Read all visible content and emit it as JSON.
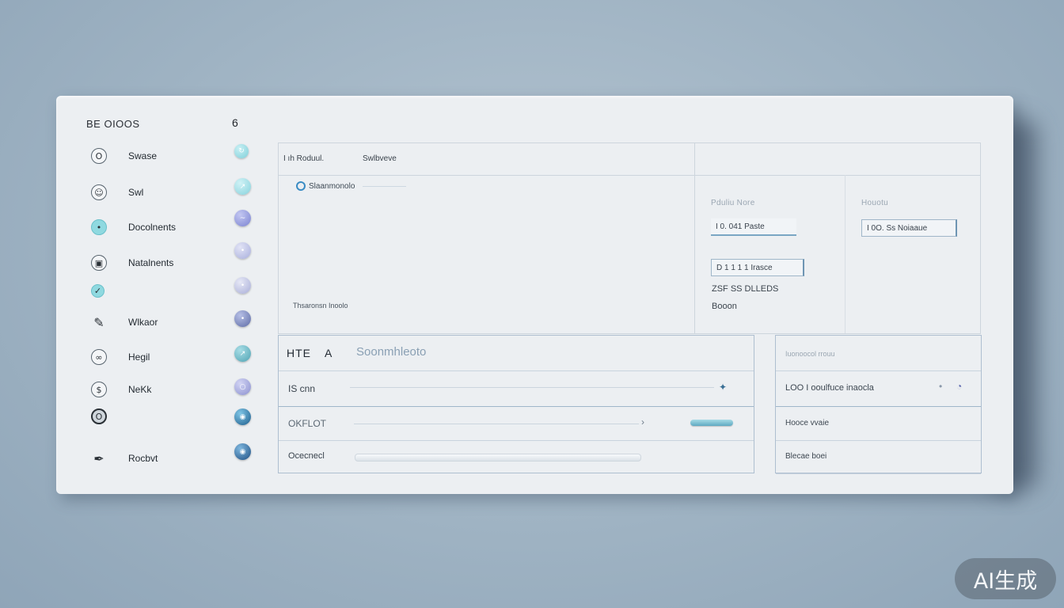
{
  "brand": {
    "name": "BE OIOOS",
    "glyph": "6"
  },
  "sidebar": {
    "items": [
      {
        "icon": "o-icon",
        "glyph": "O",
        "label": "Swase"
      },
      {
        "icon": "person-icon",
        "glyph": "☺",
        "label": "Swl"
      },
      {
        "icon": "dot-icon",
        "glyph": "•",
        "label": "Docolnents"
      },
      {
        "icon": "image-icon",
        "glyph": "▣",
        "label": "Natalnents"
      },
      {
        "icon": "check-icon",
        "glyph": "✓",
        "label": ""
      },
      {
        "icon": "bird-icon",
        "glyph": "✎",
        "label": "Wlkaor"
      },
      {
        "icon": "link-icon",
        "glyph": "∞",
        "label": "Hegil"
      },
      {
        "icon": "dollar-icon",
        "glyph": "$",
        "label": "NeKk"
      },
      {
        "icon": "ring-icon",
        "glyph": "O",
        "label": ""
      },
      {
        "icon": "pen-icon",
        "glyph": "✒",
        "label": "Rocbvt"
      }
    ],
    "orbs": [
      {
        "icon": "refresh-icon",
        "glyph": "↻",
        "color": "#7fcfd9"
      },
      {
        "icon": "arrow-icon",
        "glyph": "↗",
        "color": "#86d2dc"
      },
      {
        "icon": "wave-icon",
        "glyph": "~",
        "color": "#7b83d1"
      },
      {
        "icon": "dot-icon",
        "glyph": "•",
        "color": "#a8aedc"
      },
      {
        "icon": "dot-icon",
        "glyph": "•",
        "color": "#a9aed8"
      },
      {
        "icon": "dot-icon",
        "glyph": "•",
        "color": "#5e6ca6"
      },
      {
        "icon": "arrow-icon",
        "glyph": "↗",
        "color": "#4fa3b3"
      },
      {
        "icon": "circle-icon",
        "glyph": "○",
        "color": "#8b90cf"
      },
      {
        "icon": "globe-icon",
        "glyph": "◉",
        "color": "#1d5d8c"
      },
      {
        "icon": "globe-icon",
        "glyph": "◉",
        "color": "#1f4f82"
      }
    ]
  },
  "top_panel": {
    "tabs": [
      "I ıh Roduul.",
      "Swlbveve"
    ],
    "loader_text": "Slaanmonolo",
    "note": "Thsaronsn Inoolo",
    "right": {
      "label1": "Pduliu Nore",
      "field1": "I 0. 041 Paste",
      "label2": "Houotu",
      "field2": "I 0O. Ss Noiaaue",
      "field3": "D 1 1 1 1 Irasce",
      "text1": "ZSF SS DLLEDS",
      "text2": "Booon"
    }
  },
  "form": {
    "header_left": "HTE",
    "header_mid": "A",
    "search_value": "Soonmhleoto",
    "rows": [
      "IS cnn",
      "OKFLOT",
      "Ocecnecl"
    ]
  },
  "side_panel": {
    "header": "Iuonoocol rrouu",
    "rows": [
      "LOO I ooulfuce inaocla",
      "Hooce vvaie",
      "Blecae boei"
    ]
  },
  "watermark": "AI生成"
}
